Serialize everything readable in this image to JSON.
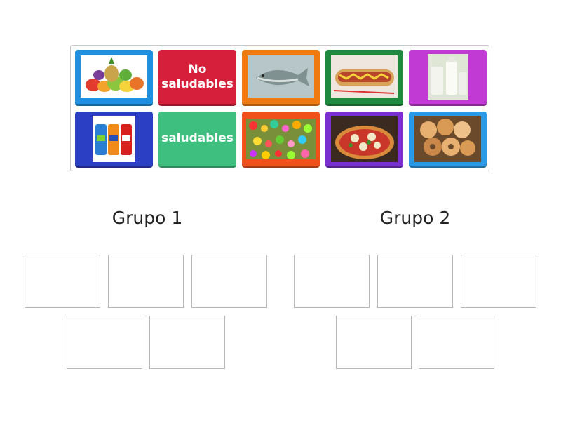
{
  "colors": {
    "blue": "#1f8fe0",
    "red": "#d61f3a",
    "orange": "#f07a12",
    "green": "#1f8a3f",
    "magenta": "#c13ad4",
    "navy": "#2a3fc4",
    "mint": "#3fbf7f",
    "orangered": "#f0501a",
    "purple": "#7a2fd0",
    "lightblue": "#2a9ae6"
  },
  "tiles": [
    {
      "icon": "fruits-image"
    },
    {
      "label": "No saludables"
    },
    {
      "icon": "fish-image"
    },
    {
      "icon": "hotdog-image"
    },
    {
      "icon": "milk-image"
    },
    {
      "icon": "soda-cans-image"
    },
    {
      "label": "saludables"
    },
    {
      "icon": "candy-image"
    },
    {
      "icon": "pizza-image"
    },
    {
      "icon": "pastries-image"
    }
  ],
  "groups": [
    {
      "title": "Grupo 1"
    },
    {
      "title": "Grupo 2"
    }
  ]
}
